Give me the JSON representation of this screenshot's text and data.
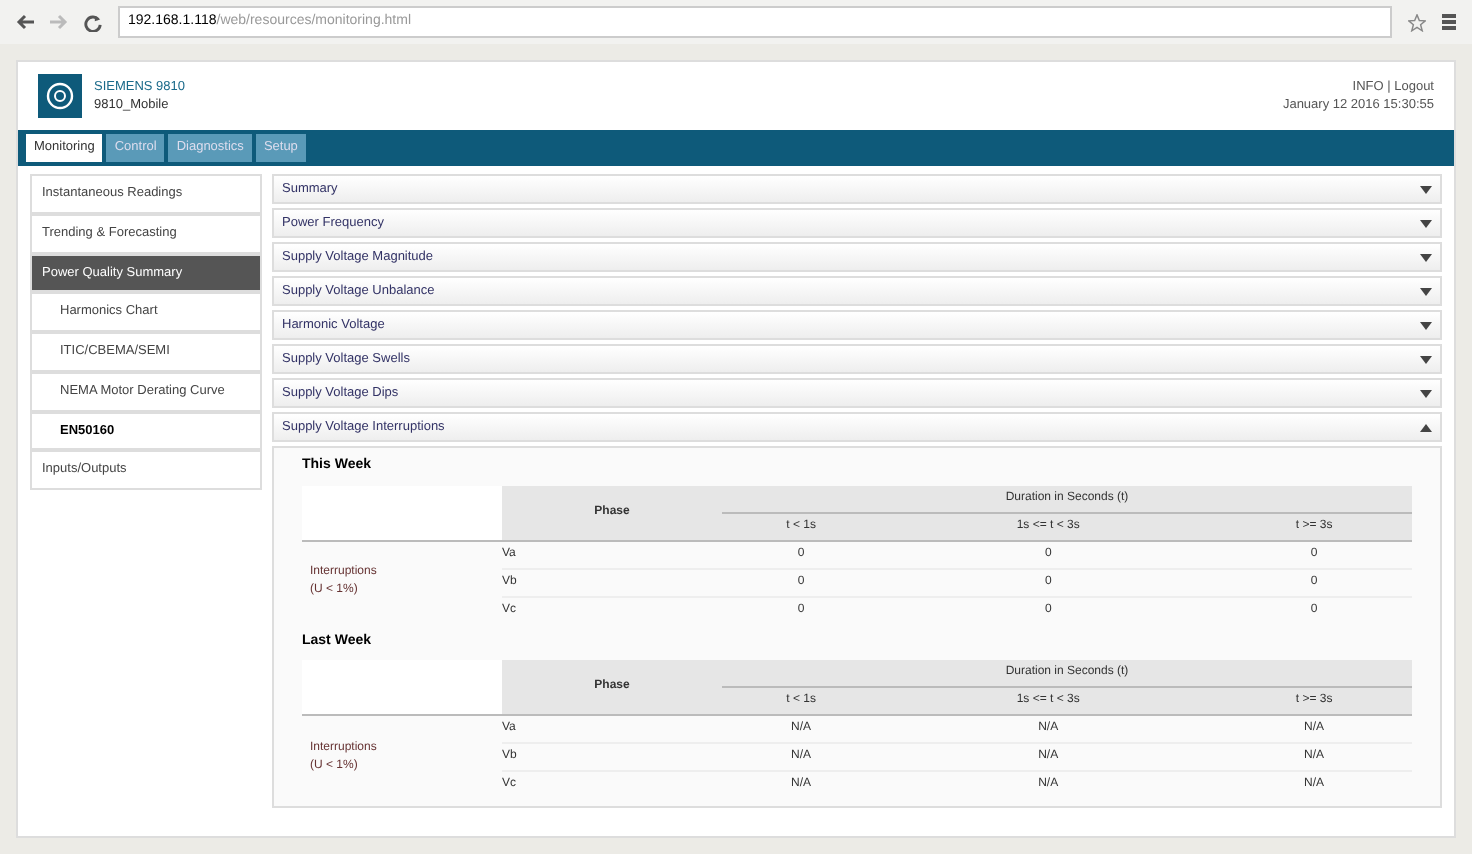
{
  "browser": {
    "url_host": "192.168.1.118",
    "url_path": "/web/resources/monitoring.html"
  },
  "header": {
    "brand": "SIEMENS 9810",
    "device": "9810_Mobile",
    "links": "INFO | Logout",
    "datetime": "January 12 2016 15:30:55"
  },
  "tabs": [
    {
      "label": "Monitoring",
      "selected": true
    },
    {
      "label": "Control",
      "selected": false
    },
    {
      "label": "Diagnostics",
      "selected": false
    },
    {
      "label": "Setup",
      "selected": false
    }
  ],
  "sidebar": {
    "items": [
      {
        "label": "Instantaneous Readings",
        "selected": false
      },
      {
        "label": "Trending & Forecasting",
        "selected": false
      },
      {
        "label": "Power Quality Summary",
        "selected": true,
        "children": [
          {
            "label": "Harmonics Chart",
            "selected": false
          },
          {
            "label": "ITIC/CBEMA/SEMI",
            "selected": false
          },
          {
            "label": "NEMA Motor Derating Curve",
            "selected": false
          },
          {
            "label": "EN50160",
            "selected": true
          }
        ]
      },
      {
        "label": "Inputs/Outputs",
        "selected": false
      }
    ]
  },
  "sections": [
    {
      "title": "Summary",
      "expanded": false
    },
    {
      "title": "Power Frequency",
      "expanded": false
    },
    {
      "title": "Supply Voltage Magnitude",
      "expanded": false
    },
    {
      "title": "Supply Voltage Unbalance",
      "expanded": false
    },
    {
      "title": "Harmonic Voltage",
      "expanded": false
    },
    {
      "title": "Supply Voltage Swells",
      "expanded": false
    },
    {
      "title": "Supply Voltage Dips",
      "expanded": false
    },
    {
      "title": "Supply Voltage Interruptions",
      "expanded": true
    }
  ],
  "tables": [
    {
      "title": "This Week",
      "phase_header": "Phase",
      "duration_header": "Duration in Seconds (t)",
      "columns": [
        "t < 1s",
        "1s <= t < 3s",
        "t >= 3s"
      ],
      "row_label": "Interruptions\n(U < 1%)",
      "rows": [
        {
          "phase": "Va",
          "values": [
            "0",
            "0",
            "0"
          ]
        },
        {
          "phase": "Vb",
          "values": [
            "0",
            "0",
            "0"
          ]
        },
        {
          "phase": "Vc",
          "values": [
            "0",
            "0",
            "0"
          ]
        }
      ]
    },
    {
      "title": "Last Week",
      "phase_header": "Phase",
      "duration_header": "Duration in Seconds (t)",
      "columns": [
        "t < 1s",
        "1s <= t < 3s",
        "t >= 3s"
      ],
      "row_label": "Interruptions\n(U < 1%)",
      "rows": [
        {
          "phase": "Va",
          "values": [
            "N/A",
            "N/A",
            "N/A"
          ]
        },
        {
          "phase": "Vb",
          "values": [
            "N/A",
            "N/A",
            "N/A"
          ]
        },
        {
          "phase": "Vc",
          "values": [
            "N/A",
            "N/A",
            "N/A"
          ]
        }
      ]
    }
  ]
}
